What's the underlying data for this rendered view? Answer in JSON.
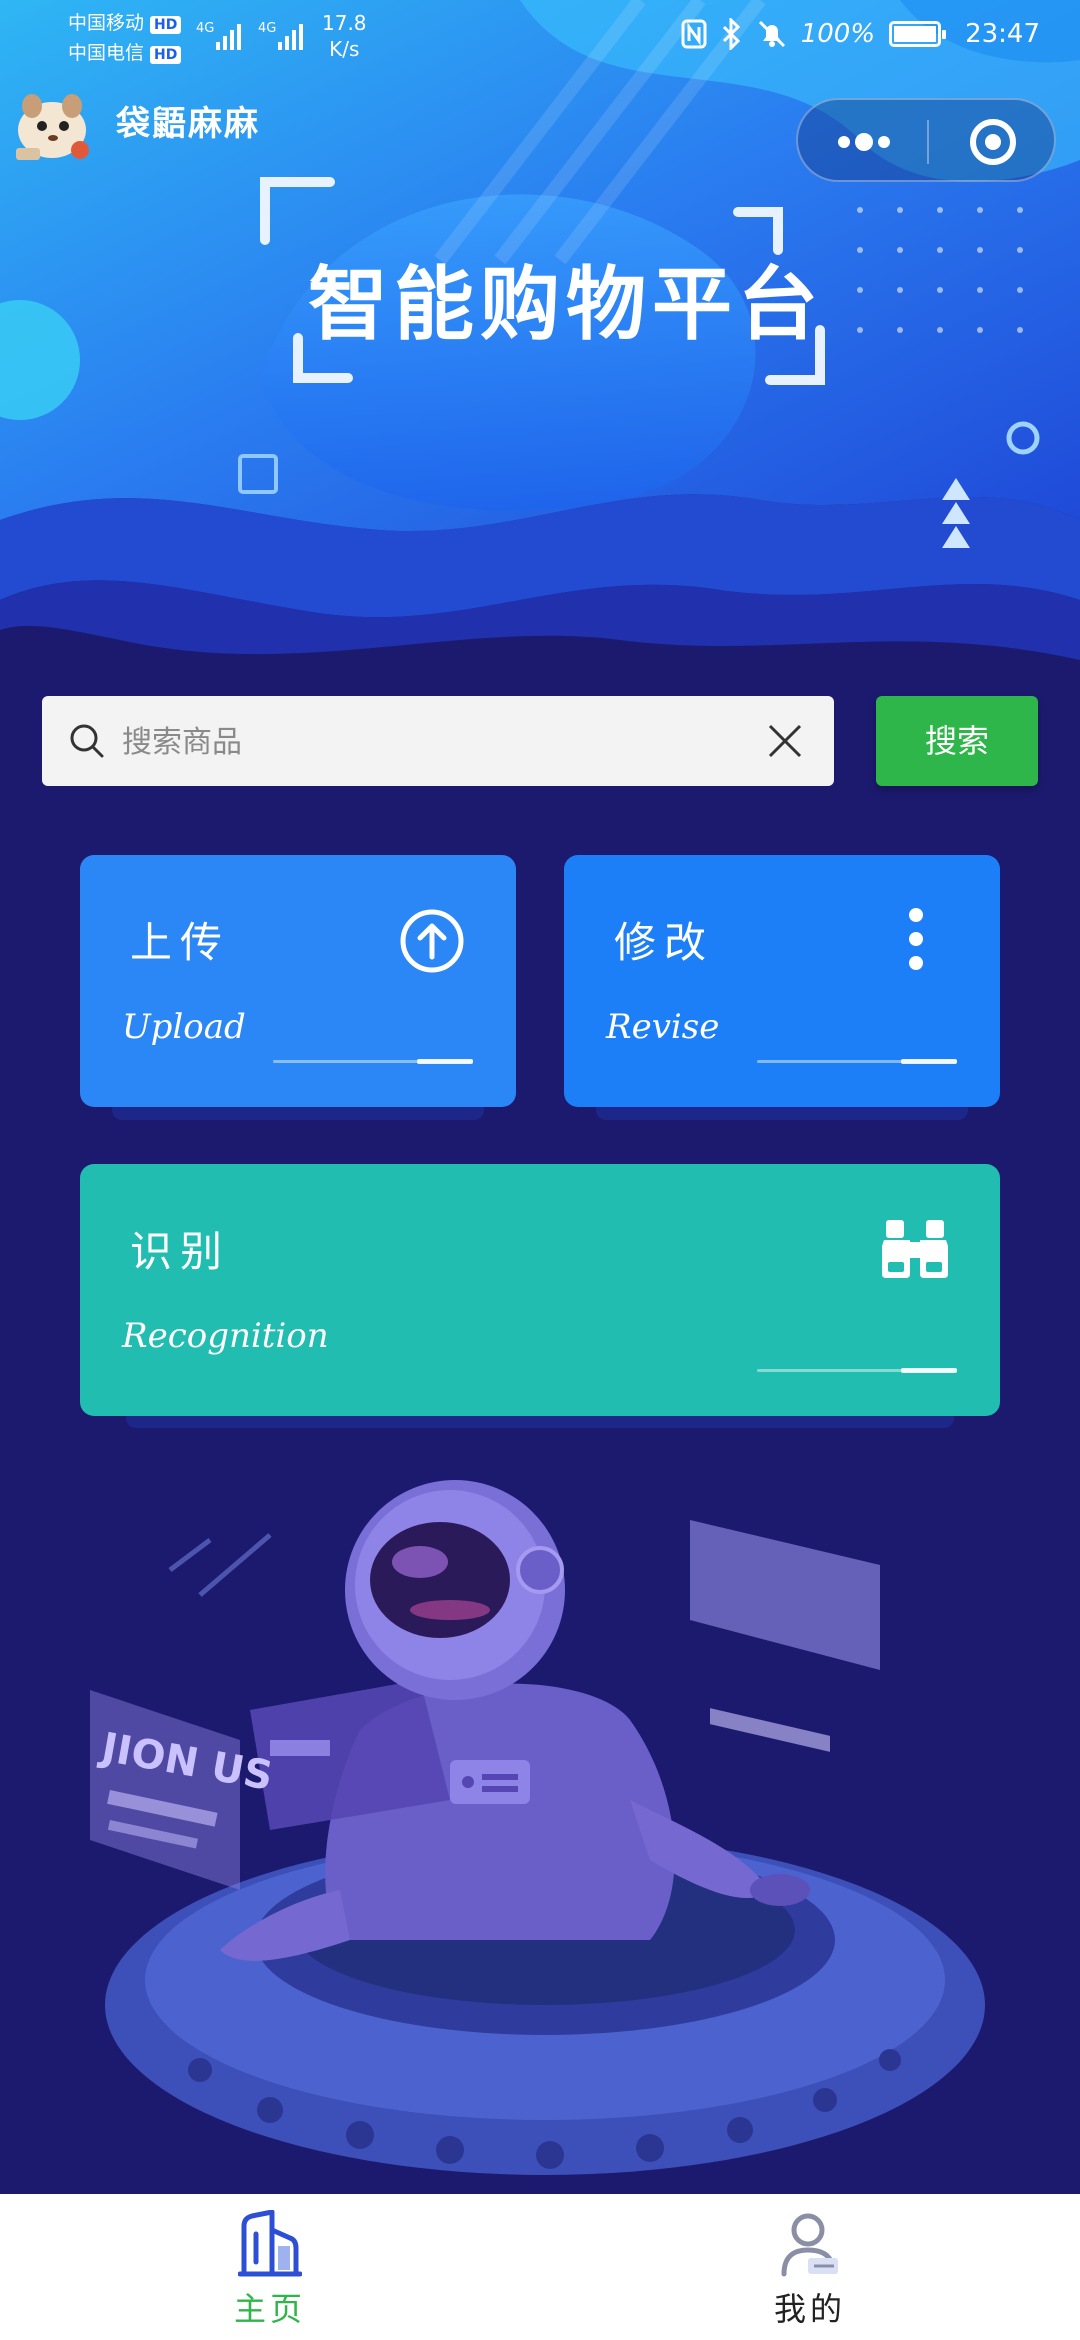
{
  "status_bar": {
    "carrier1": "中国移动",
    "carrier2": "中国电信",
    "hd": "HD",
    "network": "4G",
    "speed_value": "17.8",
    "speed_unit": "K/s",
    "battery": "100%",
    "time": "23:47"
  },
  "app": {
    "name": "袋鼯麻麻"
  },
  "banner": {
    "title": "智能购物平台"
  },
  "search": {
    "placeholder": "搜索商品",
    "value": "",
    "button_label": "搜索"
  },
  "cards": {
    "upload": {
      "title": "上传",
      "subtitle": "Upload",
      "icon": "upload-arrow-icon"
    },
    "revise": {
      "title": "修改",
      "subtitle": "Revise",
      "icon": "more-vertical-icon"
    },
    "recognition": {
      "title": "识别",
      "subtitle": "Recognition",
      "icon": "binoculars-icon"
    }
  },
  "illustration": {
    "sign_text": "JION US"
  },
  "tabbar": {
    "home_label": "主页",
    "mine_label": "我的",
    "active": "home"
  },
  "colors": {
    "page_bg": "#1c1a6e",
    "search_button": "#2fb64a",
    "upload_card": "#2b86f6",
    "revise_card": "#1d7ff8",
    "recognition_card": "#21bdb1",
    "tab_active": "#2fb64a"
  }
}
